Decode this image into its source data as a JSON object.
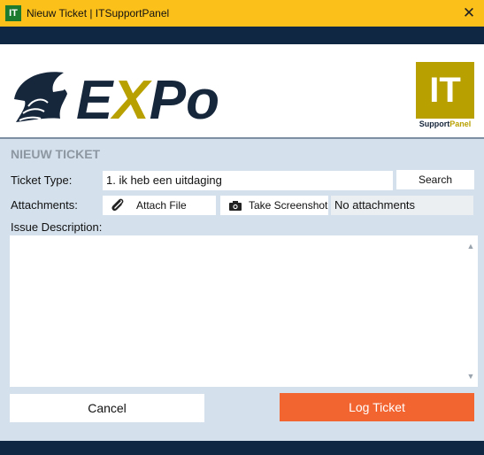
{
  "window": {
    "icon_text": "IT",
    "title": "Nieuw Ticket | ITSupportPanel",
    "close_glyph": "✕"
  },
  "logos": {
    "expo_text": "EXPo",
    "it_text": "IT",
    "it_sub_part1": "Support",
    "it_sub_part2": "Panel"
  },
  "form": {
    "section_title": "NIEUW TICKET",
    "ticket_type_label": "Ticket Type:",
    "ticket_type_value": "1. ik heb een uitdaging",
    "search_label": "Search",
    "attachments_label": "Attachments:",
    "attach_file_label": "Attach File",
    "take_screenshot_label": "Take Screenshot",
    "attachments_status": "No attachments",
    "issue_description_label": "Issue Description:",
    "issue_description_value": ""
  },
  "actions": {
    "cancel_label": "Cancel",
    "log_ticket_label": "Log Ticket"
  },
  "colors": {
    "titlebar": "#fcc01a",
    "navy": "#0f2742",
    "gold": "#b8a000",
    "accent_orange": "#f26430",
    "panel_bg": "#d4e1ed"
  },
  "icons": [
    "app-icon",
    "close-icon",
    "paperclip-icon",
    "camera-icon",
    "chevron-up-icon",
    "chevron-down-icon"
  ]
}
